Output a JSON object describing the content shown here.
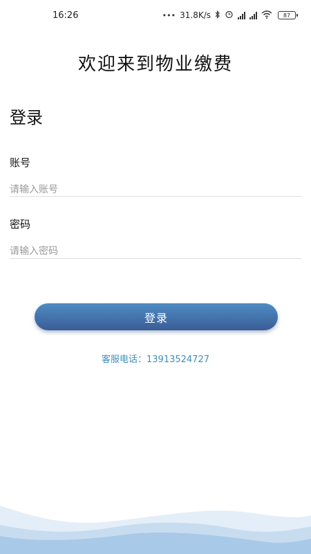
{
  "status_bar": {
    "time": "16:26",
    "network_speed": "31.8K/s",
    "battery_level": "87",
    "icons": [
      "dots-icon",
      "bluetooth-icon",
      "alarm-icon",
      "signal-hd-icon",
      "signal-hd-icon",
      "wifi-icon",
      "battery-icon"
    ]
  },
  "welcome_title": "欢迎来到物业缴费",
  "login_form": {
    "title": "登录",
    "account": {
      "label": "账号",
      "placeholder": "请输入账号",
      "value": ""
    },
    "password": {
      "label": "密码",
      "placeholder": "请输入密码",
      "value": ""
    },
    "submit_label": "登录"
  },
  "service": {
    "label": "客服电话：",
    "phone": "13913524727"
  },
  "colors": {
    "button_top": "#4f8cc3",
    "button_bottom": "#3a5d97",
    "service_text": "#3e8fb8",
    "wave_light": "#e3eef8",
    "wave_dark": "#a9c9e8"
  }
}
